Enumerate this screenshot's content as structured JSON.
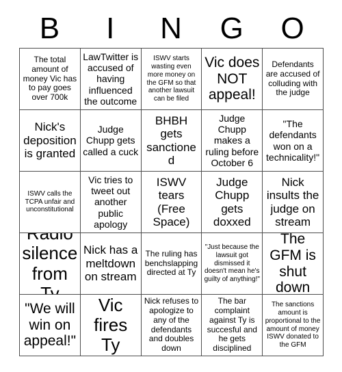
{
  "card": {
    "title_letters": [
      "B",
      "I",
      "N",
      "G",
      "O"
    ],
    "grid_size": 5,
    "free_space_index": 12,
    "colors": {
      "background": "#ffffff",
      "text": "#000000",
      "grid_line": "#4d4d4d"
    },
    "cells": [
      {
        "text": "The total amount of money Vic has to pay goes over 700k",
        "size": "s"
      },
      {
        "text": "LawTwitter is accused of having influenced the outcome",
        "size": "m"
      },
      {
        "text": "ISWV starts wasting even more money on the GFM so that another lawsuit can be filed",
        "size": "xs"
      },
      {
        "text": "Vic does NOT appeal!",
        "size": "xl"
      },
      {
        "text": "Defendants are accused of colluding with the judge",
        "size": "s"
      },
      {
        "text": "Nick's deposition is granted",
        "size": "l"
      },
      {
        "text": "Judge Chupp gets called a cuck",
        "size": "m"
      },
      {
        "text": "BHBH gets sanctioned",
        "size": "l"
      },
      {
        "text": "Judge Chupp makes a ruling before October 6",
        "size": "m"
      },
      {
        "text": "\"The defendants won on a technicality!\"",
        "size": "m"
      },
      {
        "text": "ISWV calls the TCPA unfair and unconstitutional",
        "size": "xs"
      },
      {
        "text": "Vic tries to tweet out another public apology",
        "size": "m"
      },
      {
        "text": "ISWV tears (Free Space)",
        "size": "l"
      },
      {
        "text": "Judge Chupp gets doxxed",
        "size": "l"
      },
      {
        "text": "Nick insults the judge on stream",
        "size": "l"
      },
      {
        "text": "Radio silence from Ty",
        "size": "xxl"
      },
      {
        "text": "Nick has a meltdown on stream",
        "size": "l"
      },
      {
        "text": "The ruling has benchslapping directed at Ty",
        "size": "s"
      },
      {
        "text": "\"Just because the lawsuit got dismissed it doesn't mean he's guilty of anything!\"",
        "size": "xs"
      },
      {
        "text": "The GFM is shut down",
        "size": "xl"
      },
      {
        "text": "\"We will win on appeal!\"",
        "size": "xl"
      },
      {
        "text": "Vic fires Ty",
        "size": "xxl"
      },
      {
        "text": "Nick refuses to apologize to any of the defendants and doubles down",
        "size": "s"
      },
      {
        "text": "The bar complaint against Ty is succesful and he gets disciplined",
        "size": "s"
      },
      {
        "text": "The sanctions amount is proportional to the amount of money ISWV donated to the GFM",
        "size": "xs"
      }
    ]
  }
}
